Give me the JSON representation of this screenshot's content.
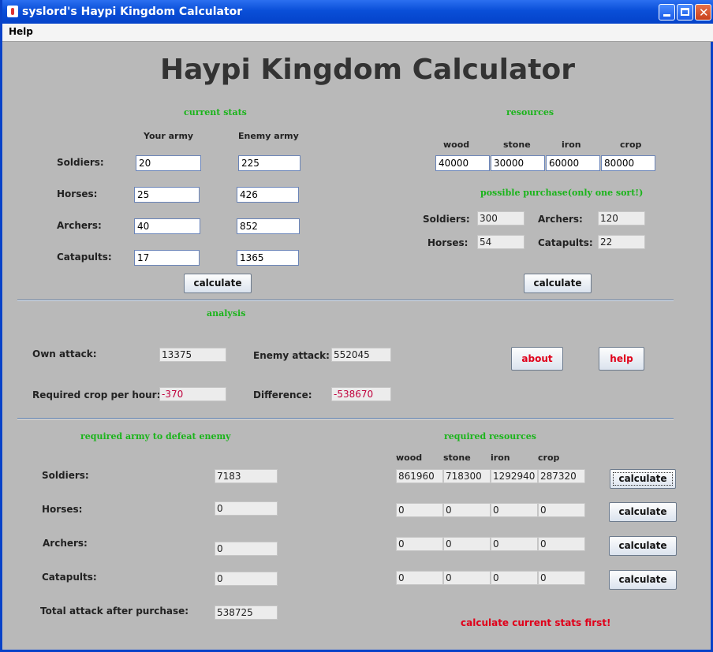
{
  "window": {
    "title": "syslord's Haypi Kingdom Calculator"
  },
  "menu": {
    "help": "Help"
  },
  "heading": "Haypi Kingdom Calculator",
  "current_stats": {
    "section_title": "current stats",
    "your_army_label": "Your army",
    "enemy_army_label": "Enemy army",
    "rows": [
      {
        "label": "Soldiers:",
        "yours": "20",
        "enemy": "225"
      },
      {
        "label": "Horses:",
        "yours": "25",
        "enemy": "426"
      },
      {
        "label": "Archers:",
        "yours": "40",
        "enemy": "852"
      },
      {
        "label": "Catapults:",
        "yours": "17",
        "enemy": "1365"
      }
    ],
    "calculate_label": "calculate"
  },
  "resources": {
    "section_title": "resources",
    "columns": [
      {
        "label": "wood",
        "value": "40000"
      },
      {
        "label": "stone",
        "value": "30000"
      },
      {
        "label": "iron",
        "value": "60000"
      },
      {
        "label": "crop",
        "value": "80000"
      }
    ],
    "purchase_title": "possible purchase(only one sort!)",
    "purchase": {
      "soldiers_label": "Soldiers:",
      "soldiers": "300",
      "archers_label": "Archers:",
      "archers": "120",
      "horses_label": "Horses:",
      "horses": "54",
      "catapults_label": "Catapults:",
      "catapults": "22"
    },
    "calculate_label": "calculate"
  },
  "analysis": {
    "section_title": "analysis",
    "own_attack_label": "Own attack:",
    "own_attack": "13375",
    "enemy_attack_label": "Enemy attack:",
    "enemy_attack": "552045",
    "crop_label": "Required crop per hour:",
    "crop": "-370",
    "difference_label": "Difference:",
    "difference": "-538670",
    "about_label": "about",
    "help_label": "help"
  },
  "required_army": {
    "section_title": "required army to defeat enemy",
    "rows": [
      {
        "label": "Soldiers:",
        "value": "7183"
      },
      {
        "label": "Horses:",
        "value": "0"
      },
      {
        "label": "Archers:",
        "value": "0"
      },
      {
        "label": "Catapults:",
        "value": "0"
      }
    ],
    "total_label": "Total attack after purchase:",
    "total": "538725"
  },
  "required_resources": {
    "section_title": "required resources",
    "headers": [
      "wood",
      "stone",
      "iron",
      "crop"
    ],
    "rows": [
      [
        "861960",
        "718300",
        "1292940",
        "287320"
      ],
      [
        "0",
        "0",
        "0",
        "0"
      ],
      [
        "0",
        "0",
        "0",
        "0"
      ],
      [
        "0",
        "0",
        "0",
        "0"
      ]
    ],
    "calculate_label": "calculate",
    "warning": "calculate current stats first!"
  }
}
